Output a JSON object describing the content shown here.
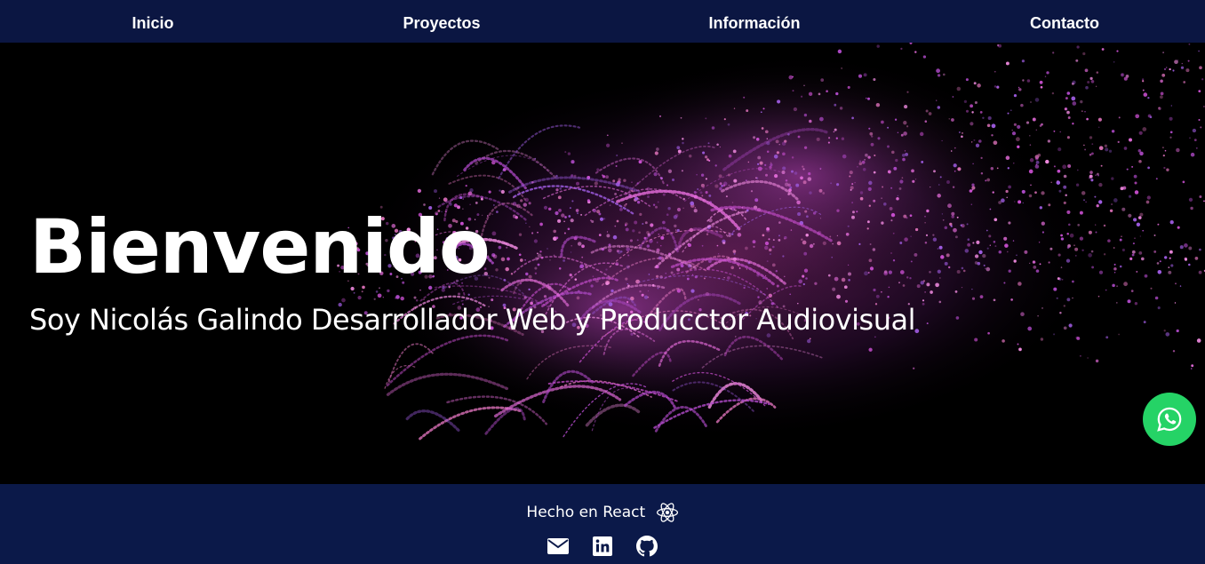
{
  "nav": {
    "items": [
      {
        "label": "Inicio"
      },
      {
        "label": "Proyectos"
      },
      {
        "label": "Información"
      },
      {
        "label": "Contacto"
      }
    ]
  },
  "hero": {
    "title": "Bienvenido",
    "subtitle": "Soy Nicolás Galindo Desarrollador Web y Producctor Audiovisual"
  },
  "footer": {
    "made_with": "Hecho en React",
    "icons": [
      "react-icon",
      "envelope-icon",
      "linkedin-icon",
      "github-icon"
    ]
  },
  "floating": {
    "icon": "whatsapp-icon"
  },
  "colors": {
    "navbar": "#0b1642",
    "footer": "#0b1949",
    "whatsapp": "#25d366",
    "particles": "#d24fd6"
  }
}
